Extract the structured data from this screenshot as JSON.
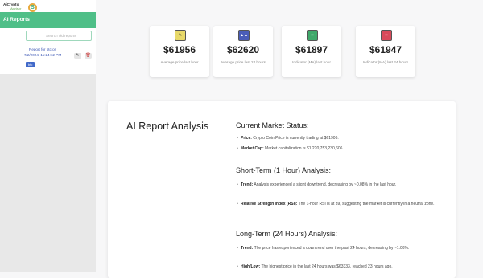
{
  "logo": {
    "line1": "AiCrypto",
    "line2": "Advisor",
    "mark": "S"
  },
  "sidebar": {
    "header": "AI Reports",
    "search_placeholder": "Search old reports",
    "report": {
      "title": "Report for btc on",
      "date": "7/2/2024, 11:24:12 PM",
      "edit_icon": "✎",
      "delete_icon": "🗑",
      "badge": "btc"
    }
  },
  "cards": [
    {
      "value": "$61956",
      "label": "Average price last hour",
      "icon": "pencil",
      "icon_color": "#e8d96a"
    },
    {
      "value": "$62620",
      "label": "Average price last 24 hours",
      "icon": "chart",
      "icon_color": "#4a5db8"
    },
    {
      "value": "$61897",
      "label": "Indicator (MA) last hour",
      "icon": "indicator",
      "icon_color": "#3fa86a"
    },
    {
      "value": "$61947",
      "label": "Indicator (MA) last 24 hours",
      "icon": "indicator",
      "icon_color": "#d84a5a"
    }
  ],
  "analysis": {
    "title": "AI Report Analysis",
    "current": {
      "heading": "Current Market Status:",
      "price_label": "Price:",
      "price_text": " Crypto Coin Price is currently trading at $61906.",
      "cap_label": "Market Cap:",
      "cap_text": " Market capitalization is $1,220,753,230,606."
    },
    "short": {
      "heading": "Short-Term (1 Hour) Analysis:",
      "trend_label": "Trend:",
      "trend_text": " Analysis experienced a slight downtrend, decreasing by ~0.08% in the last hour.",
      "rsi_label": "Relative Strength Index (RSI):",
      "rsi_text": " The 1-hour RSI is at 39, suggesting the market is currently in a neutral zone."
    },
    "long": {
      "heading": "Long-Term (24 Hours) Analysis:",
      "trend_label": "Trend:",
      "trend_text": " The price has experienced a downtrend over the past 24 hours, decreasing by ~1.06%.",
      "hl_label": "High/Low:",
      "hl_text": " The highest price in the last 24 hours was $63333, reached 23 hours ago."
    }
  }
}
